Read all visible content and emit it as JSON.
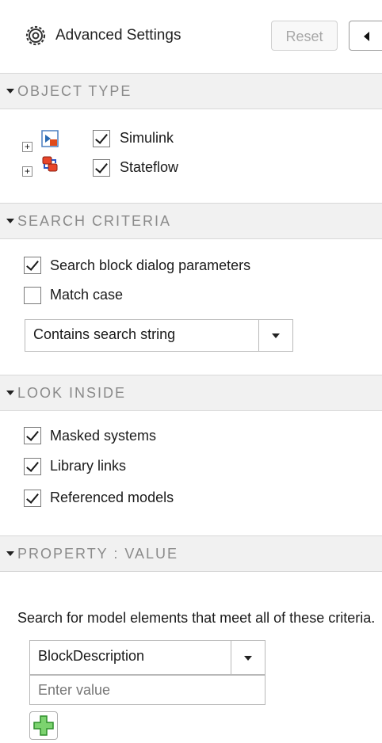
{
  "header": {
    "title": "Advanced Settings",
    "reset_label": "Reset",
    "icons": {
      "settings": "gear-icon",
      "collapse": "collapse-left-icon"
    }
  },
  "object_type": {
    "title": "OBJECT TYPE",
    "items": [
      {
        "label": "Simulink",
        "checked": true,
        "icon": "simulink-block-icon"
      },
      {
        "label": "Stateflow",
        "checked": true,
        "icon": "stateflow-chart-icon"
      }
    ]
  },
  "search_criteria": {
    "title": "SEARCH CRITERIA",
    "options": [
      {
        "label": "Search block dialog parameters",
        "checked": true
      },
      {
        "label": "Match case",
        "checked": false
      }
    ],
    "match_mode": "Contains search string"
  },
  "look_inside": {
    "title": "LOOK INSIDE",
    "options": [
      {
        "label": "Masked systems",
        "checked": true
      },
      {
        "label": "Library links",
        "checked": true
      },
      {
        "label": "Referenced models",
        "checked": true
      }
    ]
  },
  "property_value": {
    "title": "PROPERTY : VALUE",
    "description": "Search for model elements that meet all of these criteria.",
    "property": "BlockDescription",
    "value_placeholder": "Enter value",
    "add_icon": "add-plus-icon"
  },
  "colors": {
    "section_bg": "#f1f1f1",
    "section_text": "#8a8a8a",
    "add_green": "#35a93a"
  }
}
